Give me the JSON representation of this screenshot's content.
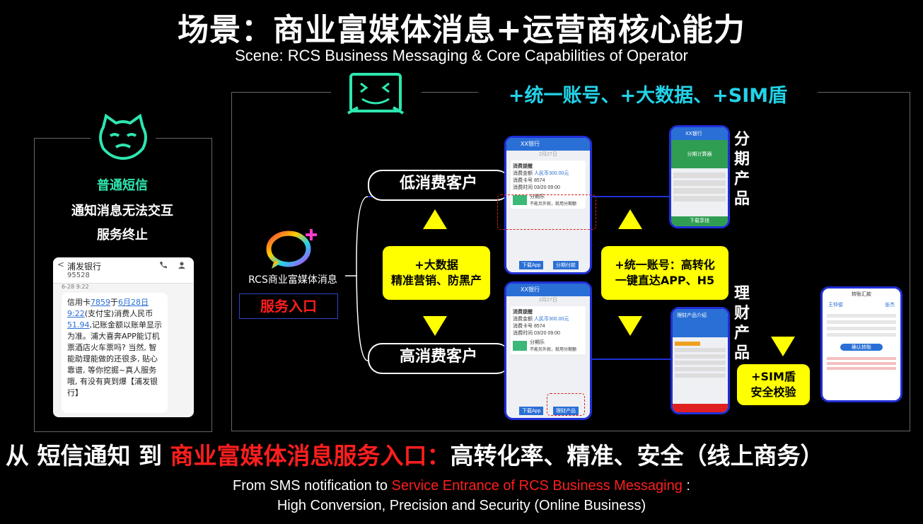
{
  "title": "场景：商业富媒体消息+运营商核心能力",
  "subtitle": "Scene: RCS Business Messaging & Core Capabilities of Operator",
  "left_panel": {
    "heading": "普通短信",
    "line1": "通知消息无法交互",
    "line2": "服务终止",
    "sms": {
      "back": "<",
      "contact": "浦发银行",
      "number": "95528",
      "date": "6-28 9:22",
      "body_pre": "信用卡",
      "card_no": "7859",
      "body_yu": "于",
      "date_link": "6月28日",
      "time_link": "9:22",
      "body_mid": "(支付宝)消费人民币",
      "amount": "51.94",
      "body_rest": ",记账金额以账单显示为准。浦大喜奔APP能订机票酒店火车票吗? 当然, 智能助理能做的还很多, 贴心靠谱, 等你挖掘~真人服务哦, 有没有爽到爆【浦发银行】"
    }
  },
  "right_panel": {
    "top_caption": "+统一账号、+大数据、+SIM盾",
    "rcs_label": "RCS商业富媒体消息",
    "service_entry": "服务入口",
    "low_customer": "低消费客户",
    "high_customer": "高消费客户",
    "bigdata_box": {
      "line1": "+大数据",
      "line2": "精准营销、防黑产"
    },
    "account_box": {
      "line1": "+统一账号：高转化",
      "line2": "一键直达APP、H5"
    },
    "sim_box": {
      "line1": "+SIM盾",
      "line2": "安全校验"
    },
    "installment_label": "分期产品",
    "finance_label": "理财产品",
    "phone_bank": {
      "header": "XX银行",
      "date": "2月27日",
      "card_title": "消费提醒",
      "amount_label": "消费金额",
      "amount": "人民币300.00元",
      "card_label": "消费卡号",
      "card_no": "8574",
      "time_label": "消费时间",
      "time": "03/20 09:00",
      "promo": "分期乐",
      "promo_sub": "不能另外就，就用分期额",
      "btn_app": "下载App",
      "btn_install": "分期付款",
      "btn_product": "理财产品"
    },
    "phone_installment": {
      "header": "XX银行",
      "banner": "分期计算器",
      "btn": "下载享钱"
    },
    "phone_finance": {
      "header": "理财产品介绍"
    },
    "phone_transfer": {
      "header": "转账汇款",
      "name1": "王仲俊",
      "name2": "张杰",
      "btn": "确认转账"
    }
  },
  "bottom": {
    "line1_a": "从 短信通知 到 ",
    "line1_b": "商业富媒体消息服务入口：",
    "line1_c": "高转化率、精准、安全（线上商务）",
    "line2_a": "From SMS notification to ",
    "line2_b": "Service Entrance of RCS Business Messaging",
    "line2_c": " :",
    "line3": "High Conversion, Precision and Security (Online Business)"
  }
}
